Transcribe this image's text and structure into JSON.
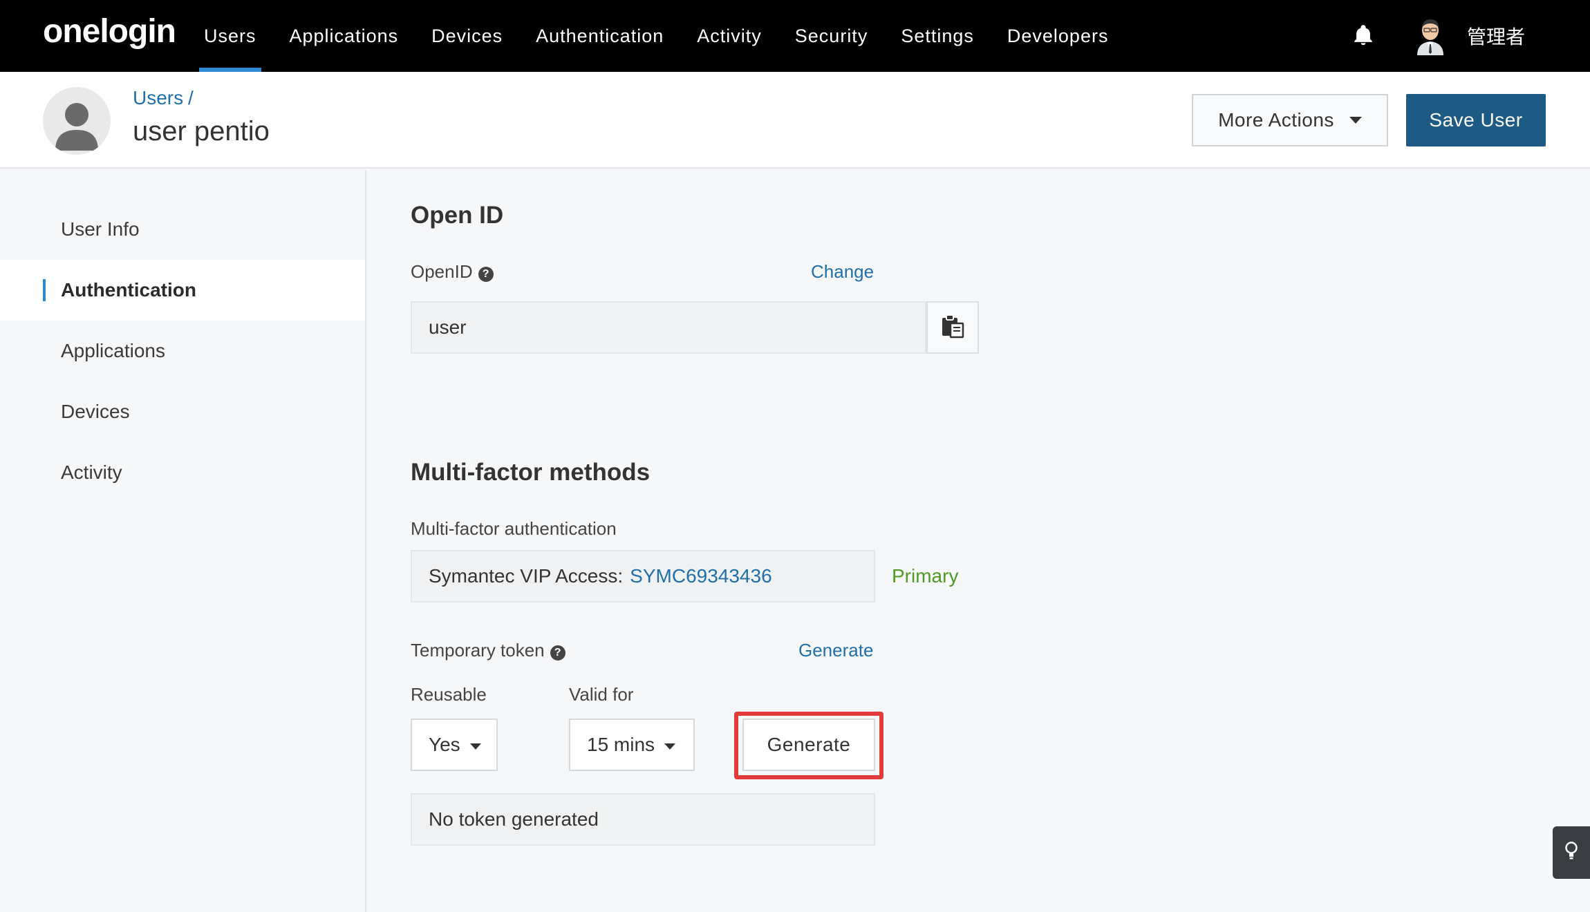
{
  "brand": {
    "logo": "onelogin"
  },
  "nav": {
    "items": [
      {
        "label": "Users",
        "active": true
      },
      {
        "label": "Applications"
      },
      {
        "label": "Devices"
      },
      {
        "label": "Authentication"
      },
      {
        "label": "Activity"
      },
      {
        "label": "Security"
      },
      {
        "label": "Settings"
      },
      {
        "label": "Developers"
      }
    ],
    "admin_name": "管理者"
  },
  "header": {
    "breadcrumb": "Users",
    "breadcrumb_sep": "/",
    "title": "user pentio",
    "more_actions": "More Actions",
    "save": "Save User"
  },
  "sidebar": {
    "items": [
      {
        "label": "User Info"
      },
      {
        "label": "Authentication",
        "active": true
      },
      {
        "label": "Applications"
      },
      {
        "label": "Devices"
      },
      {
        "label": "Activity"
      }
    ]
  },
  "openid": {
    "section_title": "Open ID",
    "label": "OpenID",
    "change_link": "Change",
    "value": "user"
  },
  "mfa": {
    "section_title": "Multi-factor methods",
    "label": "Multi-factor authentication",
    "method_name": "Symantec VIP Access:",
    "method_id": "SYMC69343436",
    "primary": "Primary"
  },
  "temp_token": {
    "label": "Temporary token",
    "generate_link": "Generate",
    "reusable_label": "Reusable",
    "reusable_value": "Yes",
    "valid_label": "Valid for",
    "valid_value": "15 mins",
    "generate_button": "Generate",
    "status": "No token generated"
  },
  "colors": {
    "accent": "#2d8bd6",
    "save_button": "#1e5b84",
    "link": "#1f6fa8",
    "primary": "#4f9a22",
    "highlight": "#e23b3b"
  }
}
